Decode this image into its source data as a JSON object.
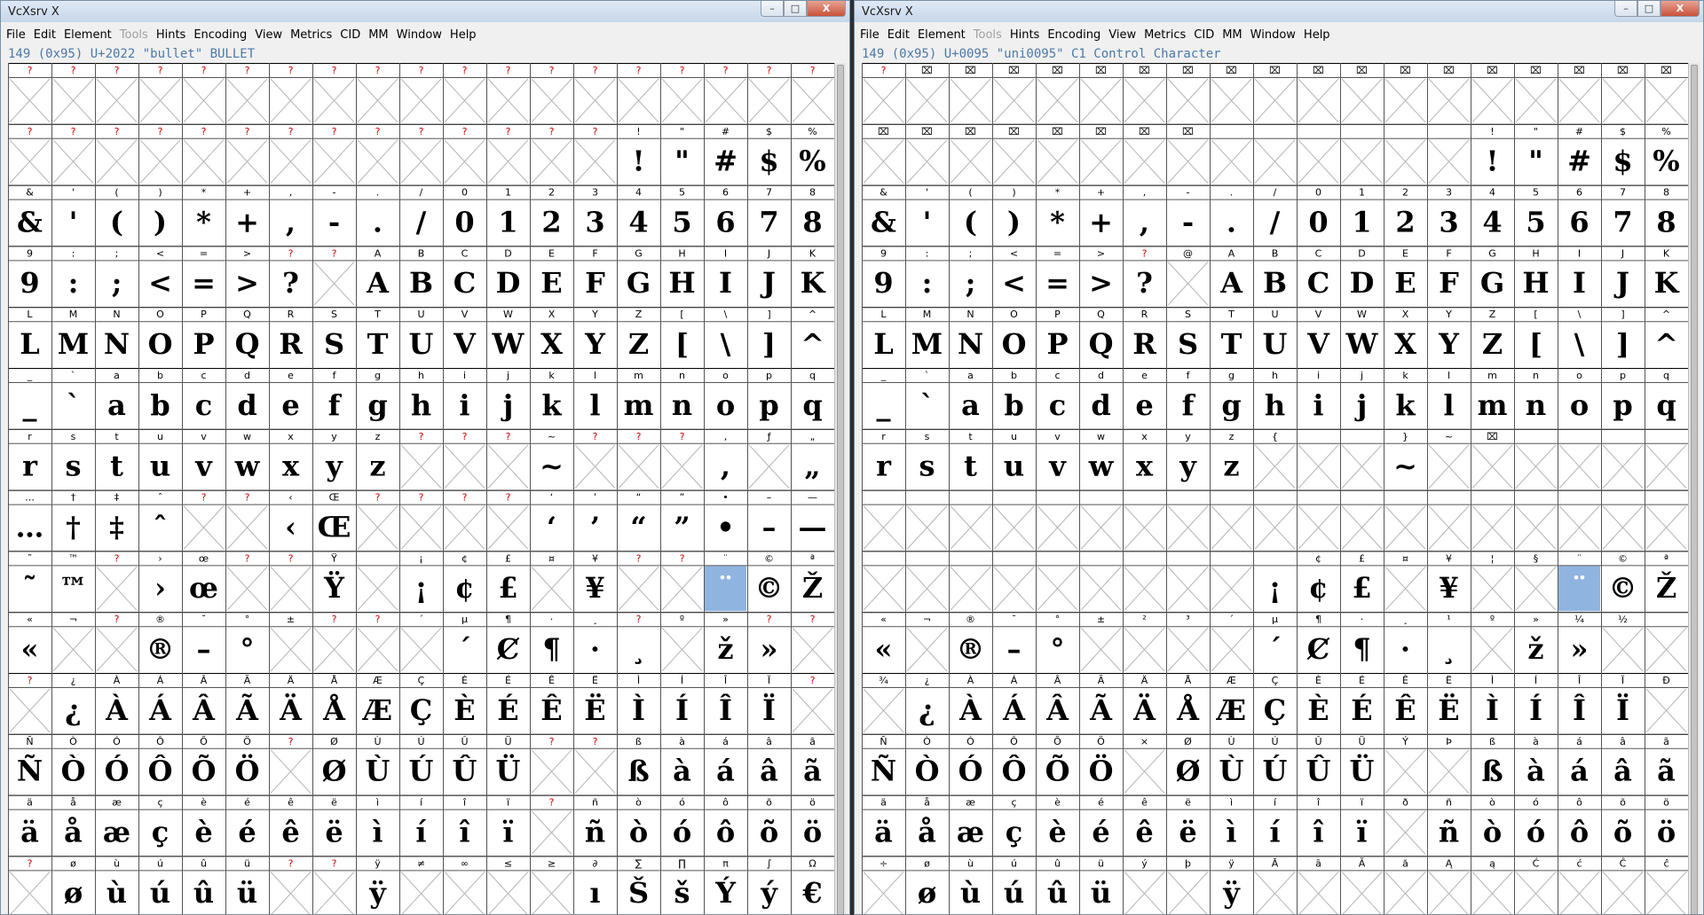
{
  "palette": {
    "label_red": "#cc0000",
    "label_black": "#000000",
    "selected": "#8fb4e0",
    "info": "#4c78a8"
  },
  "windows": [
    {
      "title": "VcXsrv X",
      "controls": [
        "–",
        "□",
        "X"
      ],
      "menus": [
        "File",
        "Edit",
        "Element",
        "Tools",
        "Hints",
        "Encoding",
        "View",
        "Metrics",
        "CID",
        "MM",
        "Window",
        "Help"
      ],
      "disabled_menus": [
        "Tools"
      ],
      "status": "149 (0x95) U+2022 \"bullet\" BULLET",
      "selected": [
        8,
        16
      ],
      "rows": [
        {
          "l": "?|?|?|?|?|?|?|?|?|?|?|?|?|?|?|?|?|?|?",
          "g": "|||||||||||||||||||"
        },
        {
          "l": "?|?|?|?|?|?|?|?|?|?|?|?|?|?|!|\"|#|$|%",
          "g": "||||||||||||||!|\"|#|$|%"
        },
        {
          "l": "&|'|(|)|*|+|,|-|.|/|0|1|2|3|4|5|6|7|8",
          "g": "&|'|(|)|*|+|,|-|.|/|0|1|2|3|4|5|6|7|8"
        },
        {
          "l": "9|:|;|<|=|>|?|?|A|B|C|D|E|F|G|H|I|J|K",
          "g": "9|:|;|<|=|>|?||A|B|C|D|E|F|G|H|I|J|K"
        },
        {
          "l": "L|M|N|O|P|Q|R|S|T|U|V|W|X|Y|Z|[|\\|]|^",
          "g": "L|M|N|O|P|Q|R|S|T|U|V|W|X|Y|Z|[|\\|]|^"
        },
        {
          "l": "_|`|a|b|c|d|e|f|g|h|i|j|k|l|m|n|o|p|q",
          "g": "_|`|a|b|c|d|e|f|g|h|i|j|k|l|m|n|o|p|q"
        },
        {
          "l": "r|s|t|u|v|w|x|y|z|?|?|?|~|?|?|?|,|ƒ|„",
          "g": "r|s|t|u|v|w|x|y|z||||~||||,||„"
        },
        {
          "l": "…|†|‡|ˆ|?|?|‹|Œ|?|?|?|?|‘|’|“|”|•|–|—",
          "g": "…|†|‡|ˆ|||‹|Œ|||||‘|’|“|”|•|–|—"
        },
        {
          "l": "˜|™|?|›|œ|?|?|Ÿ||¡|¢|£|¤|¥|?|?|¨|©|ª",
          "g": "˜|™||›|œ|||Ÿ||¡|¢|£||¥|||¨|©|Ž"
        },
        {
          "l": "«|¬|?|®|¯|°|±|?|?|´|µ|¶|·|¸|?|º|»|?|?",
          "g": "«|||®|–|°|||||´|Ȼ|¶|·|¸||ž|»||"
        },
        {
          "l": "?|¿|À|Á|Â|Ã|Ä|Å|Æ|Ç|È|É|Ê|Ë|Ì|Í|Î|Ï|?",
          "g": "|¿|À|Á|Â|Ã|Ä|Å|Æ|Ç|È|É|Ê|Ë|Ì|Í|Î|Ï|"
        },
        {
          "l": "Ñ|Ò|Ó|Ô|Õ|Ö|?|Ø|Ù|Ú|Û|Ü|?|?|ß|à|á|â|ã",
          "g": "Ñ|Ò|Ó|Ô|Õ|Ö||Ø|Ù|Ú|Û|Ü|||ß|à|á|â|ã"
        },
        {
          "l": "ä|å|æ|ç|è|é|ê|ë|ì|í|î|ï|?|ñ|ò|ó|ô|õ|ö",
          "g": "ä|å|æ|ç|è|é|ê|ë|ì|í|î|ï||ñ|ò|ó|ô|õ|ö"
        },
        {
          "l": "?|ø|ù|ú|û|ü|?|?|ÿ|≠|∞|≤|≥|∂|∑|∏|π|∫|Ω",
          "g": "|ø|ù|ú|û|ü|||ÿ|||||ı|Š|š|Ý|ý|€"
        }
      ]
    },
    {
      "title": "VcXsrv X",
      "controls": [
        "–",
        "□",
        "X"
      ],
      "menus": [
        "File",
        "Edit",
        "Element",
        "Tools",
        "Hints",
        "Encoding",
        "View",
        "Metrics",
        "CID",
        "MM",
        "Window",
        "Help"
      ],
      "disabled_menus": [
        "Tools"
      ],
      "status": "149 (0x95) U+0095 \"uni0095\" C1 Control Character",
      "selected": [
        8,
        16
      ],
      "rows": [
        {
          "l": "?|⌧|⌧|⌧|⌧|⌧|⌧|⌧|⌧|⌧|⌧|⌧|⌧|⌧|⌧|⌧|⌧|⌧|⌧",
          "g": "|||||||||||||||||||"
        },
        {
          "l": "⌧|⌧|⌧|⌧|⌧|⌧|⌧|⌧|||||||!|\"|#|$|%",
          "g": "||||||||||||||!|\"|#|$|%"
        },
        {
          "l": "&|'|(|)|*|+|,|-|.|/|0|1|2|3|4|5|6|7|8",
          "g": "&|'|(|)|*|+|,|-|.|/|0|1|2|3|4|5|6|7|8"
        },
        {
          "l": "9|:|;|<|=|>|?|@|A|B|C|D|E|F|G|H|I|J|K",
          "g": "9|:|;|<|=|>|?||A|B|C|D|E|F|G|H|I|J|K"
        },
        {
          "l": "L|M|N|O|P|Q|R|S|T|U|V|W|X|Y|Z|[|\\|]|^",
          "g": "L|M|N|O|P|Q|R|S|T|U|V|W|X|Y|Z|[|\\|]|^"
        },
        {
          "l": "_|`|a|b|c|d|e|f|g|h|i|j|k|l|m|n|o|p|q",
          "g": "_|`|a|b|c|d|e|f|g|h|i|j|k|l|m|n|o|p|q"
        },
        {
          "l": "r|s|t|u|v|w|x|y|z|{|||}|~|⌧|||||",
          "g": "r|s|t|u|v|w|x|y|z||||~||||||"
        },
        {
          "l": "|||||||||||||||||||",
          "g": "|||||||||||||||||||"
        },
        {
          "l": "||||||||||¢|£|¤|¥|¦|§|¨|©|ª",
          "g": "|||||||||¡|¢|£||¥|||¨|©|Ž"
        },
        {
          "l": "«|¬|®|¯|°|±|²|³|´|µ|¶|·|¸|¹|º|»|¼|½|",
          "g": "«||®|–|°|||||´|Ȼ|¶|·|¸||ž|»||"
        },
        {
          "l": "¾|¿|À|Á|Â|Ã|Ä|Å|Æ|Ç|È|É|Ê|Ë|Ì|Í|Î|Ï|Ð",
          "g": "|¿|À|Á|Â|Ã|Ä|Å|Æ|Ç|È|É|Ê|Ë|Ì|Í|Î|Ï|"
        },
        {
          "l": "Ñ|Ò|Ó|Ô|Õ|Ö|×|Ø|Ù|Ú|Û|Ü|Ý|Þ|ß|à|á|â|ã",
          "g": "Ñ|Ò|Ó|Ô|Õ|Ö||Ø|Ù|Ú|Û|Ü|||ß|à|á|â|ã"
        },
        {
          "l": "ä|å|æ|ç|è|é|ê|ë|ì|í|î|ï|ð|ñ|ò|ó|ô|õ|ö",
          "g": "ä|å|æ|ç|è|é|ê|ë|ì|í|î|ï||ñ|ò|ó|ô|õ|ö"
        },
        {
          "l": "÷|ø|ù|ú|û|ü|ý|þ|ÿ|Ā|ā|Ă|ă|Ą|ą|Ć|ć|Ĉ|ĉ",
          "g": "|ø|ù|ú|û|ü|||ÿ||||||||||"
        }
      ]
    }
  ]
}
